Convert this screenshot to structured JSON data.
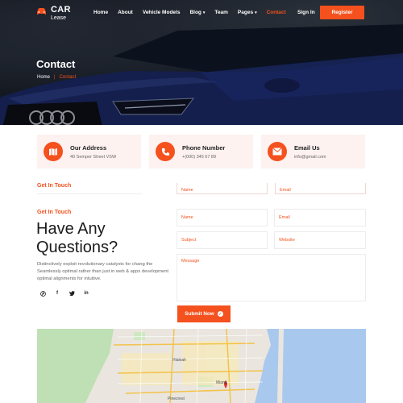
{
  "brand": {
    "title": "CAR",
    "subtitle": "Lease",
    "accent": "#f4511e"
  },
  "nav": {
    "items": [
      {
        "label": "Home",
        "has_caret": false,
        "active": false
      },
      {
        "label": "About",
        "has_caret": false,
        "active": false
      },
      {
        "label": "Vehicle Models",
        "has_caret": false,
        "active": false
      },
      {
        "label": "Blog",
        "has_caret": true,
        "active": false
      },
      {
        "label": "Team",
        "has_caret": false,
        "active": false
      },
      {
        "label": "Pages",
        "has_caret": true,
        "active": false
      },
      {
        "label": "Contact",
        "has_caret": false,
        "active": true
      }
    ],
    "caret": "▾",
    "signin": "Sign In",
    "register": "Register"
  },
  "hero": {
    "title": "Contact",
    "breadcrumb": {
      "home": "Home",
      "current": "Contact"
    }
  },
  "info_cards": [
    {
      "icon": "map-icon",
      "title": "Our Address",
      "value": "40 Semper Street VSW"
    },
    {
      "icon": "phone-icon",
      "title": "Phone Number",
      "value": "+(000) 345 67 89"
    },
    {
      "icon": "email-icon",
      "title": "Email Us",
      "value": "info@gmail.com"
    }
  ],
  "ghost": {
    "heading": "Get In Touch",
    "name_placeholder": "Name",
    "email_placeholder": "Email"
  },
  "contact": {
    "eyebrow": "Get In Touch",
    "headline": "Have Any Questions?",
    "description": "Distinctively exploit revolutionary catalysts for chang the Seamlessly optimal rather than just in web & apps development optimal alignments for intuitive.",
    "socials": [
      {
        "icon": "pinterest-icon",
        "glyph": "℗"
      },
      {
        "icon": "facebook-icon",
        "glyph": "f"
      },
      {
        "icon": "twitter-icon",
        "glyph": "t"
      },
      {
        "icon": "linkedin-icon",
        "glyph": "in"
      }
    ]
  },
  "form": {
    "name_placeholder": "Name",
    "email_placeholder": "Email",
    "subject_placeholder": "Subject",
    "website_placeholder": "Website",
    "message_placeholder": "Message",
    "submit": "Submit Now",
    "submit_icon": "✓"
  },
  "map": {
    "labels": [
      "Hialeah",
      "Miami",
      "Pinecrest"
    ]
  }
}
